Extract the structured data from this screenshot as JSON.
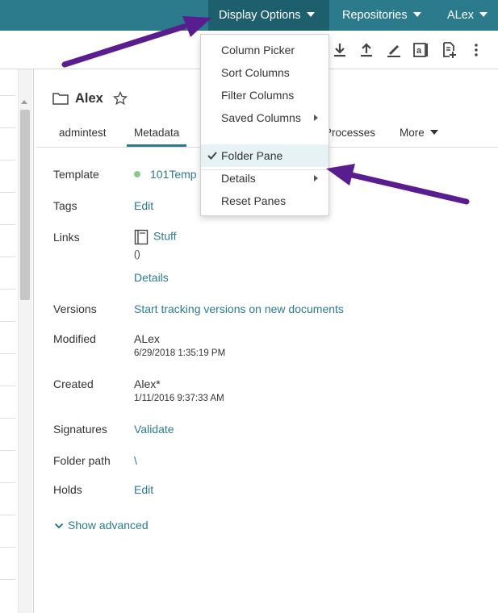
{
  "topnav": {
    "display_options": "Display Options",
    "repositories": "Repositories",
    "user": "ALex"
  },
  "toolbar": {
    "icons": [
      "download-icon",
      "upload-icon",
      "sign-icon",
      "ocr-text-icon",
      "new-document-icon",
      "more-vertical-icon"
    ]
  },
  "folder": {
    "name": "Alex"
  },
  "tabs": {
    "admintest": "admintest",
    "metadata": "Metadata",
    "processes": "Processes",
    "more": "More"
  },
  "metadata": {
    "template_label": "Template",
    "template_value": "101Temp",
    "tags_label": "Tags",
    "tags_value": "Edit",
    "links_label": "Links",
    "links_value": "Stuff",
    "links_sub": "()",
    "links_details": "Details",
    "versions_label": "Versions",
    "versions_value": "Start tracking versions on new documents",
    "modified_label": "Modified",
    "modified_by": "ALex",
    "modified_date": "6/29/2018 1:35:19 PM",
    "created_label": "Created",
    "created_by": "Alex*",
    "created_date": "1/11/2016 9:37:33 AM",
    "signatures_label": "Signatures",
    "signatures_value": "Validate",
    "folder_path_label": "Folder path",
    "folder_path_value": "\\",
    "holds_label": "Holds",
    "holds_value": "Edit",
    "show_advanced": "Show advanced"
  },
  "dropdown": {
    "column_picker": "Column Picker",
    "sort_columns": "Sort Columns",
    "filter_columns": "Filter Columns",
    "saved_columns": "Saved Columns",
    "folder_pane": "Folder Pane",
    "details": "Details",
    "reset_panes": "Reset Panes"
  },
  "colors": {
    "nav_bg": "#2c7b8c",
    "nav_active": "#1e5f6d",
    "link": "#2c7b8c",
    "annotation_arrow": "#5a1d8f"
  }
}
